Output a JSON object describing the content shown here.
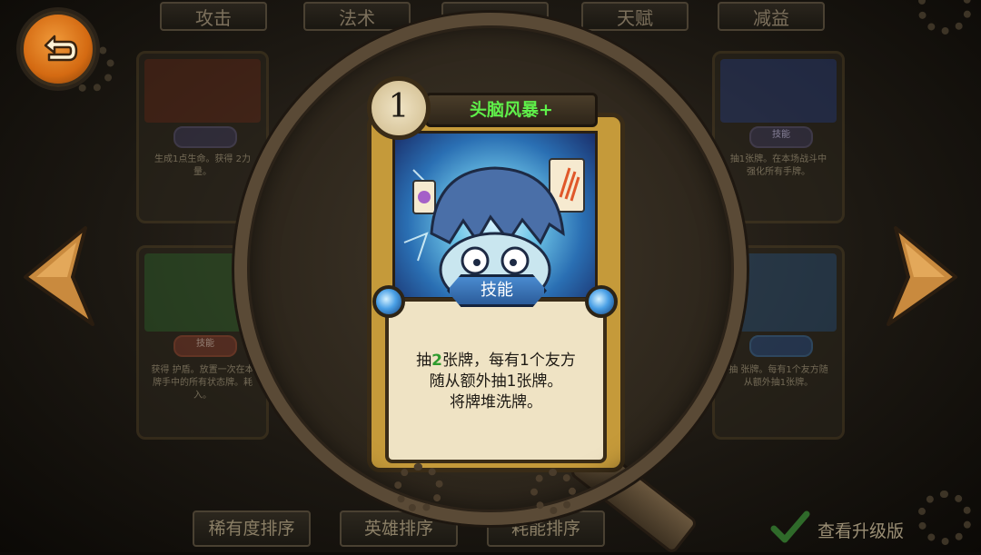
{
  "tabs": [
    "攻击",
    "法术",
    "",
    "天赋",
    "减益"
  ],
  "navigation": {
    "back_icon": "back-arrow-icon",
    "prev_icon": "left-arrow-icon",
    "next_icon": "right-arrow-icon"
  },
  "background_cards": {
    "top_left_desc": "生成1点生命。获得 2力量。",
    "top_right_type": "技能",
    "top_right_desc": "抽1张牌。在本场战斗中强化所有手牌。",
    "mid_left_type": "技能",
    "mid_left_desc": "获得 护盾。放置一次在本牌手中的所有状态牌。耗入。",
    "mid_right_desc": "抽 张牌。每有1个友方随从额外抽1张牌。"
  },
  "card": {
    "cost": "1",
    "name": "头脑风暴+",
    "type": "技能",
    "desc_prefix": "抽",
    "desc_highlight": "2",
    "desc_line1_rest": "张牌，每有1个友方",
    "desc_line2": "随从额外抽1张牌。",
    "desc_line3": "将牌堆洗牌。"
  },
  "bottom_bar": {
    "sort_rarity": "稀有度排序",
    "sort_hero": "英雄排序",
    "sort_cost": "耗能排序",
    "view_upgrade_label": "查看升级版",
    "view_upgrade_checked": true
  },
  "colors": {
    "card_name": "#5ff04a",
    "highlight_number": "#2e9b2e",
    "back_button": "#e07f24",
    "arrows": "#c98a3e"
  }
}
